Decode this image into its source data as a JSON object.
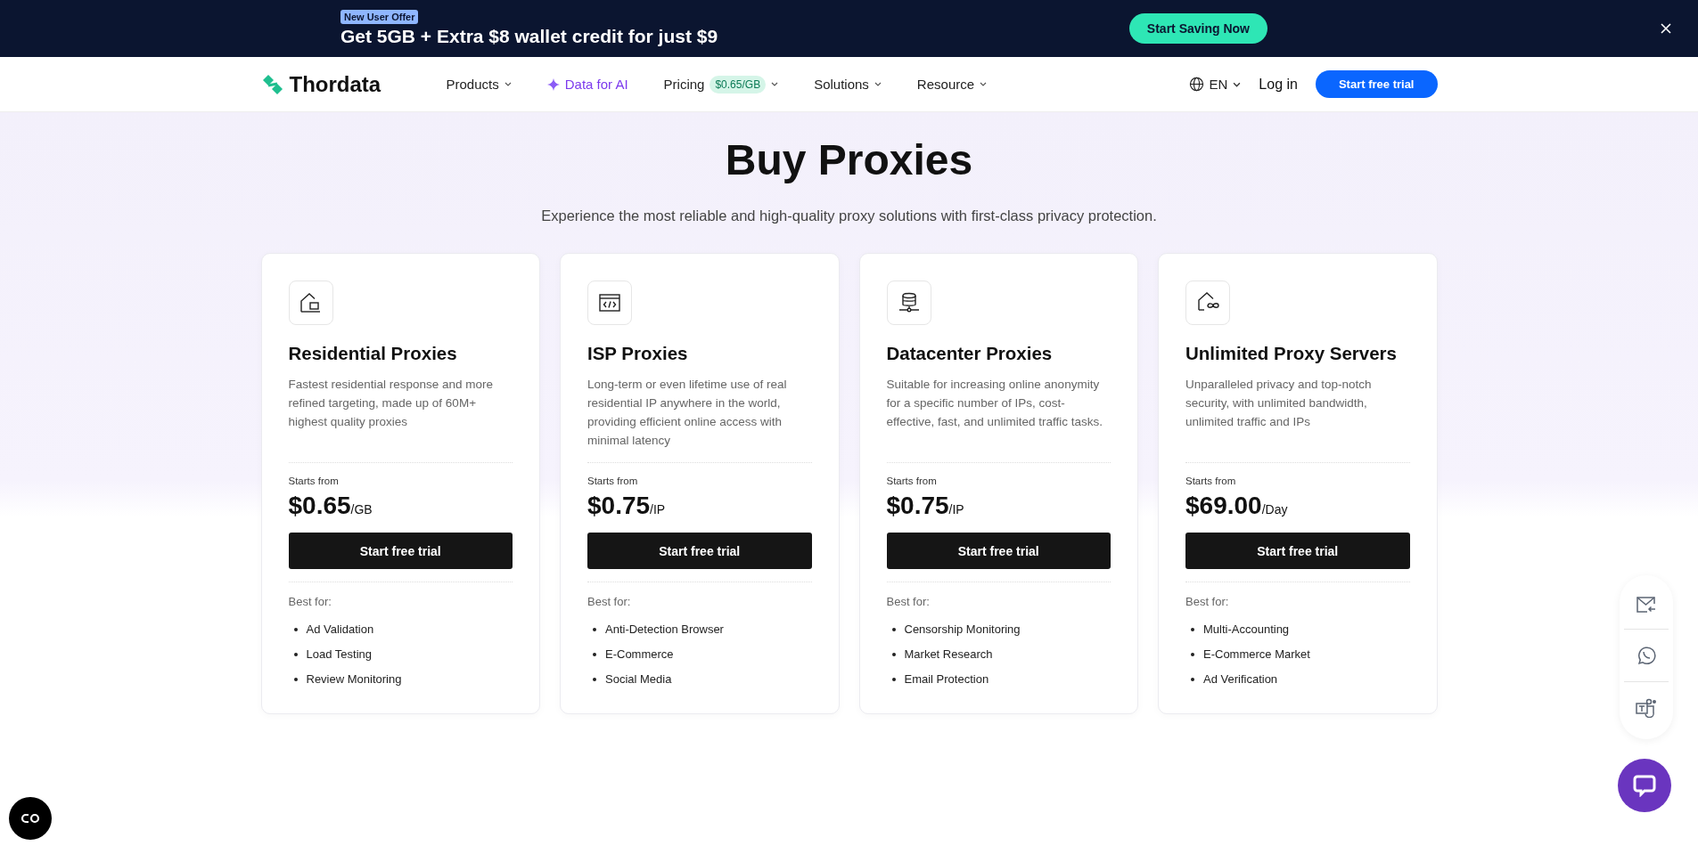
{
  "promo_banner": {
    "badge": "New User Offer",
    "headline": "Get 5GB + Extra $8 wallet credit for just $9",
    "cta": "Start Saving Now"
  },
  "nav": {
    "brand": "Thordata",
    "items": [
      {
        "label": "Products",
        "kind": "dropdown"
      },
      {
        "label": "Data for AI",
        "kind": "ai"
      },
      {
        "label": "Pricing",
        "kind": "dropdown",
        "badge": "$0.65/GB"
      },
      {
        "label": "Solutions",
        "kind": "dropdown"
      },
      {
        "label": "Resource",
        "kind": "dropdown"
      }
    ],
    "language": "EN",
    "login": "Log in",
    "cta": "Start free trial"
  },
  "hero": {
    "title": "Buy Proxies",
    "subtitle": "Experience the most reliable and high-quality proxy solutions with first-class privacy protection."
  },
  "cards": [
    {
      "title": "Residential Proxies",
      "description": "Fastest residential response and more refined targeting, made up of 60M+ highest quality proxies",
      "price_label": "Starts from",
      "price": "$0.65",
      "unit": "/GB",
      "button": "Start free trial",
      "best_for_label": "Best for:",
      "best_for": [
        "Ad Validation",
        "Load Testing",
        "Review Monitoring"
      ]
    },
    {
      "title": "ISP Proxies",
      "description": "Long-term or even lifetime use of real residential IP anywhere in the world, providing efficient online access with minimal latency",
      "price_label": "Starts from",
      "price": "$0.75",
      "unit": "/IP",
      "button": "Start free trial",
      "best_for_label": "Best for:",
      "best_for": [
        "Anti-Detection Browser",
        "E-Commerce",
        "Social Media"
      ]
    },
    {
      "title": "Datacenter Proxies",
      "description": "Suitable for increasing online anonymity for a specific number of IPs, cost-effective, fast, and unlimited traffic tasks.",
      "price_label": "Starts from",
      "price": "$0.75",
      "unit": "/IP",
      "button": "Start free trial",
      "best_for_label": "Best for:",
      "best_for": [
        "Censorship Monitoring",
        "Market Research",
        "Email Protection"
      ]
    },
    {
      "title": "Unlimited Proxy Servers",
      "description": "Unparalleled privacy and top-notch security, with unlimited bandwidth, unlimited traffic and IPs",
      "price_label": "Starts from",
      "price": "$69.00",
      "unit": "/Day",
      "button": "Start free trial",
      "best_for_label": "Best for:",
      "best_for": [
        "Multi-Accounting",
        "E-Commerce Market",
        "Ad Verification"
      ]
    }
  ]
}
